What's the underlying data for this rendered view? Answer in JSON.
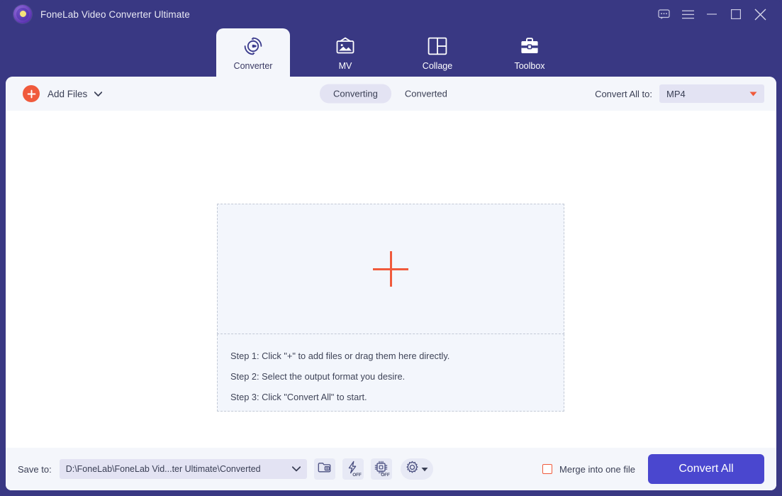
{
  "window": {
    "title": "FoneLab Video Converter Ultimate",
    "logo_icon": "fonelab-logo-icon",
    "controls": [
      {
        "name": "feedback-icon",
        "label": "Feedback"
      },
      {
        "name": "menu-icon",
        "label": "Menu"
      },
      {
        "name": "minimize-icon",
        "label": "Minimize"
      },
      {
        "name": "maximize-icon",
        "label": "Maximize"
      },
      {
        "name": "close-icon",
        "label": "Close"
      }
    ]
  },
  "nav": {
    "tabs": [
      {
        "label": "Converter",
        "icon": "converter-icon",
        "active": true
      },
      {
        "label": "MV",
        "icon": "mv-icon",
        "active": false
      },
      {
        "label": "Collage",
        "icon": "collage-icon",
        "active": false
      },
      {
        "label": "Toolbox",
        "icon": "toolbox-icon",
        "active": false
      }
    ]
  },
  "toolbar": {
    "add_files_label": "Add Files",
    "add_files_icon": "plus-circle-icon",
    "add_files_caret": "chevron-down-icon",
    "segments": [
      {
        "label": "Converting",
        "active": true
      },
      {
        "label": "Converted",
        "active": false
      }
    ],
    "convert_all_to_label": "Convert All to:",
    "format_value": "MP4",
    "format_caret": "caret-down-icon"
  },
  "main": {
    "drop_zone_icon": "plus-icon",
    "steps": [
      "Step 1: Click \"+\" to add files or drag them here directly.",
      "Step 2: Select the output format you desire.",
      "Step 3: Click \"Convert All\" to start."
    ]
  },
  "bottom": {
    "save_to_label": "Save to:",
    "save_path": "D:\\FoneLab\\FoneLab Vid...ter Ultimate\\Converted",
    "save_path_caret": "chevron-down-icon",
    "folder_button_icon": "folder-icon",
    "hardware_accel": {
      "icon": "lightning-icon",
      "state": "OFF"
    },
    "gpu_accel": {
      "icon": "chip-icon",
      "state": "OFF"
    },
    "settings_icon": "gear-icon",
    "settings_caret": "caret-down-icon",
    "merge_label": "Merge into one file",
    "merge_checked": false,
    "convert_all_label": "Convert All"
  },
  "colors": {
    "header": "#393883",
    "panel": "#ffffff",
    "toolbar": "#f4f6fb",
    "accent_orange": "#f05a3c",
    "accent_purple": "#4a47cf",
    "control_bg": "#e3e3f3",
    "dropzone_bg": "#f3f6fc",
    "dropzone_border": "#c2c9d6"
  }
}
